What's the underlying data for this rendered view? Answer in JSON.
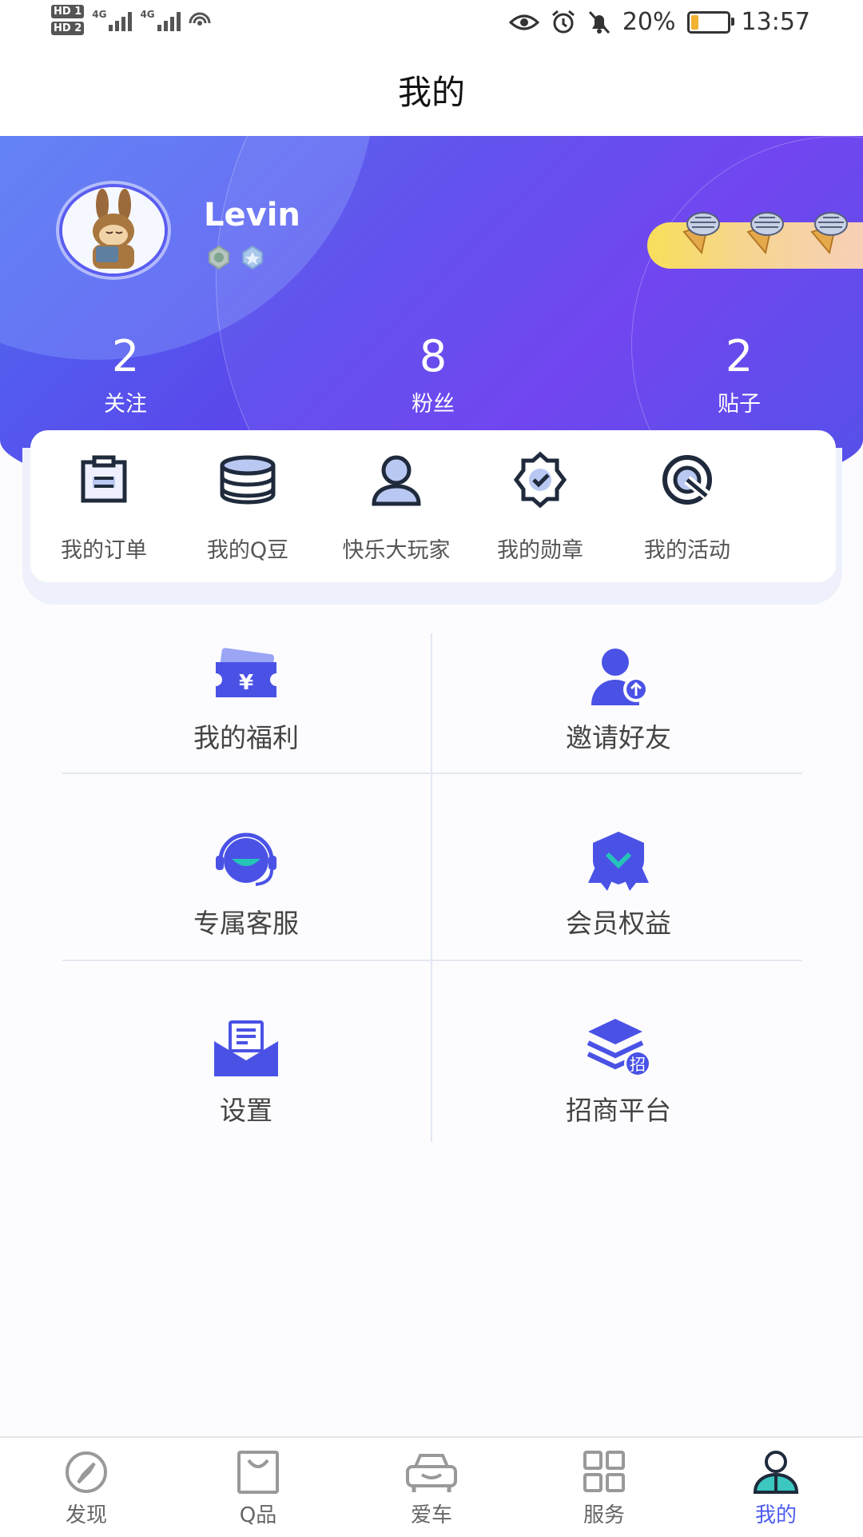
{
  "status_bar": {
    "sim1": "HD 1",
    "sim2": "HD 2",
    "net1": "4G",
    "net2": "4G",
    "battery": "20%",
    "time": "13:57",
    "icons": [
      "eye-icon",
      "alarm-icon",
      "bell-off-icon",
      "battery-icon"
    ]
  },
  "header": {
    "title": "我的"
  },
  "profile": {
    "username": "Levin",
    "stats": [
      {
        "value": "2",
        "label": "关注"
      },
      {
        "value": "8",
        "label": "粉丝"
      },
      {
        "value": "2",
        "label": "贴子"
      }
    ]
  },
  "quick_menu": [
    {
      "label": "我的订单",
      "icon": "order-icon"
    },
    {
      "label": "我的Q豆",
      "icon": "coins-icon"
    },
    {
      "label": "快乐大玩家",
      "icon": "player-icon"
    },
    {
      "label": "我的勋章",
      "icon": "medal-icon"
    },
    {
      "label": "我的活动",
      "icon": "activity-icon"
    }
  ],
  "services": [
    {
      "label": "我的福利",
      "icon": "welfare-ticket-icon"
    },
    {
      "label": "邀请好友",
      "icon": "invite-friend-icon"
    },
    {
      "label": "专属客服",
      "icon": "customer-service-icon"
    },
    {
      "label": "会员权益",
      "icon": "member-rights-icon"
    },
    {
      "label": "设置",
      "icon": "settings-icon"
    },
    {
      "label": "招商平台",
      "icon": "merchant-platform-icon",
      "badge": "招"
    }
  ],
  "tabs": [
    {
      "label": "发现",
      "icon": "compass-icon"
    },
    {
      "label": "Q品",
      "icon": "shopping-bag-icon"
    },
    {
      "label": "爱车",
      "icon": "car-icon"
    },
    {
      "label": "服务",
      "icon": "grid-icon"
    },
    {
      "label": "我的",
      "icon": "user-icon",
      "active": true
    }
  ],
  "colors": {
    "accent": "#4d5cf0",
    "hero_start": "#4c6ef0",
    "hero_end": "#6a3df0"
  }
}
